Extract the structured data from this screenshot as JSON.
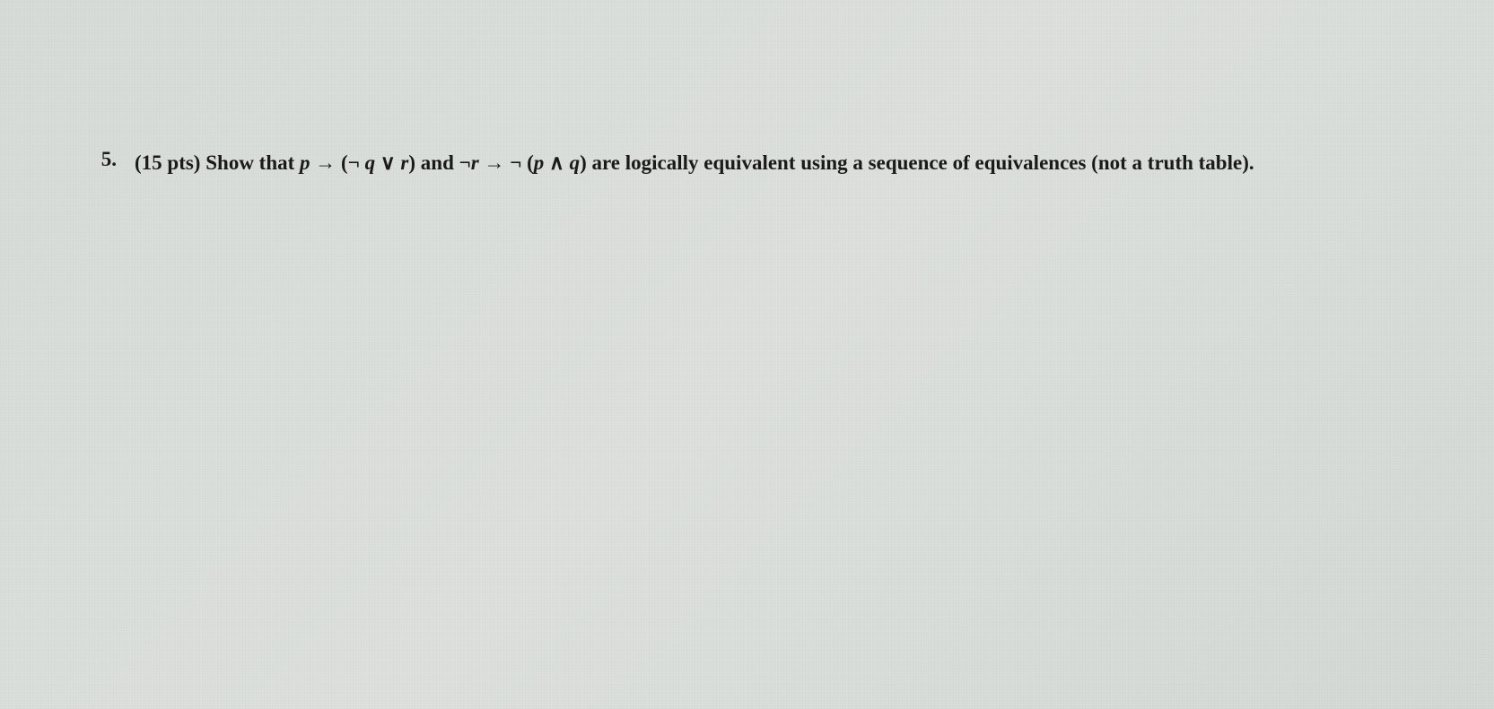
{
  "problem": {
    "number": "5.",
    "points": "(15 pts)",
    "text_before": "Show that",
    "expr1_p": "p",
    "expr1_arrow": "→",
    "expr1_lparen": "(",
    "expr1_neg": "¬",
    "expr1_q": "q",
    "expr1_or": "∨",
    "expr1_r": "r",
    "expr1_rparen": ")",
    "text_and": "and",
    "expr2_neg1": "¬",
    "expr2_r": "r",
    "expr2_arrow": "→",
    "expr2_neg2": "¬",
    "expr2_lparen": "(",
    "expr2_p": "p",
    "expr2_and": "∧",
    "expr2_q": "q",
    "expr2_rparen": ")",
    "text_after": "are logically equivalent using a sequence of equivalences (not a truth table)."
  }
}
